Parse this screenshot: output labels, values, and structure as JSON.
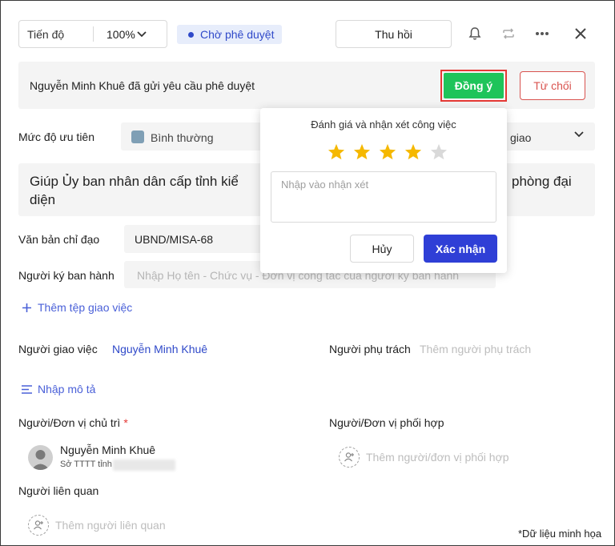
{
  "toolbar": {
    "progress_label": "Tiến độ",
    "progress_value": "100%",
    "status": "Chờ phê duyệt",
    "recall_label": "Thu hồi",
    "icons": [
      "bell-icon",
      "repeat-icon",
      "more-icon",
      "close-icon"
    ]
  },
  "approval": {
    "message": "Nguyễn Minh Khuê đã gửi yêu cầu phê duyệt",
    "approve_label": "Đồng ý",
    "reject_label": "Từ chối"
  },
  "priority": {
    "label": "Mức độ ưu tiên",
    "value": "Bình thường",
    "right_fragment": "giao"
  },
  "task": {
    "title": "Giúp Ủy ban nhân dân cấp tỉnh kiể… phòng đại diện",
    "title_left": "Giúp Ủy ban nhân dân cấp tỉnh kiể",
    "title_right": "phòng đại",
    "title_line2": "diện"
  },
  "document": {
    "label": "Văn bản chỉ đạo",
    "value": "UBND/MISA-68"
  },
  "signer": {
    "label": "Người ký ban hành",
    "placeholder": "Nhập Họ tên - Chức vụ - Đơn vị công tác của người ký ban hành"
  },
  "attach_label": "Thêm tệp giao việc",
  "assigner": {
    "label": "Người giao việc",
    "value": "Nguyễn Minh Khuê"
  },
  "owner": {
    "label": "Người phụ trách",
    "placeholder": "Thêm người phụ trách"
  },
  "description_label": "Nhập mô tả",
  "lead_unit": {
    "label": "Người/Đơn vị chủ trì",
    "required_mark": "*",
    "person_name": "Nguyễn Minh Khuê",
    "person_unit": "Sở TTTT tỉnh"
  },
  "coordinating_unit": {
    "label": "Người/Đơn vị phối hợp",
    "placeholder": "Thêm người/đơn vị phối hợp"
  },
  "related": {
    "label": "Người liên quan",
    "placeholder": "Thêm người liên quan"
  },
  "rating_popup": {
    "title": "Đánh giá và nhận xét công việc",
    "rating": 4,
    "max_rating": 5,
    "star_color": "#f5b800",
    "empty_star_color": "#d9d9d9",
    "comment_placeholder": "Nhập vào nhận xét",
    "cancel_label": "Hủy",
    "confirm_label": "Xác nhận"
  },
  "footnote": "*Dữ liệu minh họa",
  "colors": {
    "approve": "#1ec45a",
    "reject": "#d9534f",
    "primary": "#2f3fd6",
    "link": "#4a60d8"
  }
}
